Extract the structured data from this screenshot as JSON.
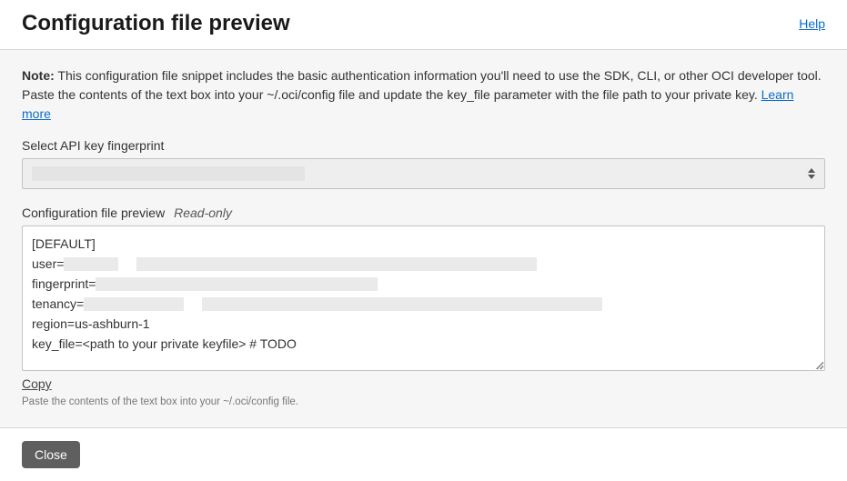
{
  "header": {
    "title": "Configuration file preview",
    "help": "Help"
  },
  "note": {
    "bold": "Note:",
    "text": " This configuration file snippet includes the basic authentication information you'll need to use the SDK, CLI, or other OCI developer tool. Paste the contents of the text box into your ~/.oci/config file and update the key_file parameter with the file path to your private key. ",
    "learn_more": "Learn more"
  },
  "select": {
    "label": "Select API key fingerprint",
    "value": ""
  },
  "preview": {
    "label": "Configuration file preview",
    "readonly": "Read-only",
    "lines": {
      "l0": "[DEFAULT]",
      "l1_prefix": "user=",
      "l2_prefix": "fingerprint=",
      "l3_prefix": "tenancy=",
      "l4": "region=us-ashburn-1",
      "l5": "key_file=<path to your private keyfile> # TODO"
    }
  },
  "copy": "Copy",
  "hint": "Paste the contents of the text box into your ~/.oci/config file.",
  "footer": {
    "close": "Close"
  }
}
